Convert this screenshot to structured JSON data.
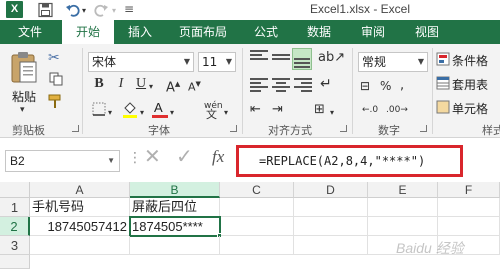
{
  "window": {
    "title": "Excel1.xlsx - Excel",
    "app_icon_letter": "X"
  },
  "tabs": [
    {
      "label": "文件",
      "active": false
    },
    {
      "label": "开始",
      "active": true
    },
    {
      "label": "插入",
      "active": false
    },
    {
      "label": "页面布局",
      "active": false
    },
    {
      "label": "公式",
      "active": false
    },
    {
      "label": "数据",
      "active": false
    },
    {
      "label": "审阅",
      "active": false
    },
    {
      "label": "视图",
      "active": false
    }
  ],
  "ribbon": {
    "clipboard": {
      "paste_label": "粘贴",
      "group_label": "剪贴板"
    },
    "font": {
      "font_name": "宋体",
      "font_size": "11",
      "bold": "B",
      "italic": "I",
      "underline": "U",
      "phonetic": "wén",
      "group_label": "字体"
    },
    "alignment": {
      "group_label": "对齐方式"
    },
    "number": {
      "format": "常规",
      "group_label": "数字"
    },
    "styles": {
      "conditional_format": "条件格",
      "table_format": "套用表",
      "cell_styles": "单元格",
      "group_label": "样式"
    }
  },
  "formula_bar": {
    "name_box": "B2",
    "fx_label": "fx",
    "formula": "=REPLACE(A2,8,4,\"****\")"
  },
  "sheet": {
    "columns": [
      "A",
      "B",
      "C",
      "D",
      "E",
      "F"
    ],
    "rows": [
      "1",
      "2",
      "3"
    ],
    "cells": {
      "A1": "手机号码",
      "B1": "屏蔽后四位",
      "A2": "18745057412",
      "B2": "1874505****"
    },
    "active_cell": "B2"
  },
  "watermark": "Baidu 经验",
  "colors": {
    "excel_green": "#217346",
    "highlight_red": "#d9262c"
  }
}
